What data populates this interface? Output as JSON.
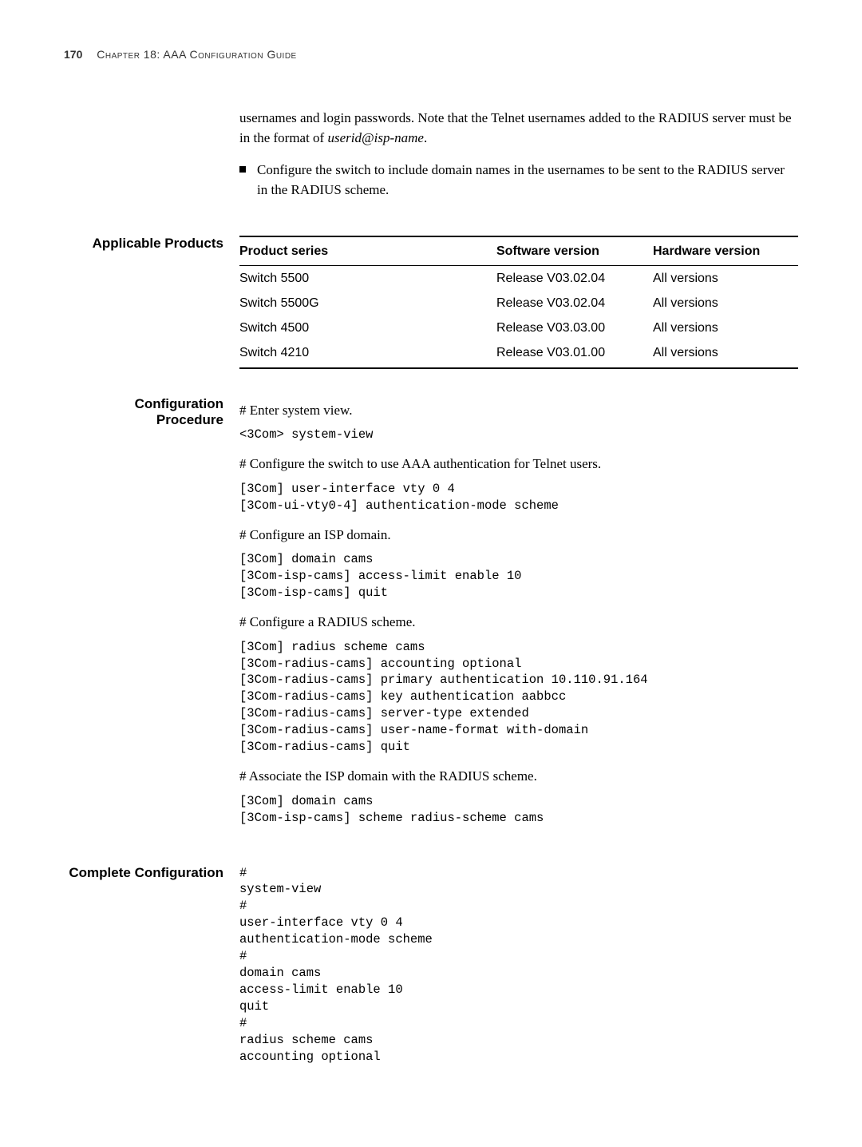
{
  "header": {
    "page_number": "170",
    "chapter": "Chapter 18: AAA Configuration Guide"
  },
  "intro": {
    "p1a": "usernames and login passwords. Note that the Telnet usernames added to the RADIUS server must be in the format of ",
    "p1b": "userid@isp-name",
    "p1c": ".",
    "bullet1": "Configure the switch to include domain names in the usernames to be sent to the RADIUS server in the RADIUS scheme."
  },
  "applicable": {
    "label": "Applicable Products",
    "headers": {
      "product": "Product series",
      "software": "Software version",
      "hardware": "Hardware version"
    },
    "rows": [
      {
        "product": "Switch 5500",
        "software": "Release V03.02.04",
        "hardware": "All versions"
      },
      {
        "product": "Switch 5500G",
        "software": "Release V03.02.04",
        "hardware": "All versions"
      },
      {
        "product": "Switch 4500",
        "software": "Release V03.03.00",
        "hardware": "All versions"
      },
      {
        "product": "Switch 4210",
        "software": "Release V03.01.00",
        "hardware": "All versions"
      }
    ]
  },
  "config_procedure": {
    "label": "Configuration Procedure",
    "step1": "# Enter system view.",
    "cmd1": "<3Com> system-view",
    "step2": "# Configure the switch to use AAA authentication for Telnet users.",
    "cmd2": "[3Com] user-interface vty 0 4\n[3Com-ui-vty0-4] authentication-mode scheme",
    "step3": "# Configure an ISP domain.",
    "cmd3": "[3Com] domain cams\n[3Com-isp-cams] access-limit enable 10\n[3Com-isp-cams] quit",
    "step4": "# Configure a RADIUS scheme.",
    "cmd4": "[3Com] radius scheme cams\n[3Com-radius-cams] accounting optional\n[3Com-radius-cams] primary authentication 10.110.91.164\n[3Com-radius-cams] key authentication aabbcc\n[3Com-radius-cams] server-type extended\n[3Com-radius-cams] user-name-format with-domain\n[3Com-radius-cams] quit",
    "step5": "# Associate the ISP domain with the RADIUS scheme.",
    "cmd5": "[3Com] domain cams\n[3Com-isp-cams] scheme radius-scheme cams"
  },
  "complete_config": {
    "label": "Complete Configuration",
    "cmd": "#\nsystem-view\n#\nuser-interface vty 0 4\nauthentication-mode scheme\n#\ndomain cams\naccess-limit enable 10\nquit\n#\nradius scheme cams\naccounting optional"
  }
}
